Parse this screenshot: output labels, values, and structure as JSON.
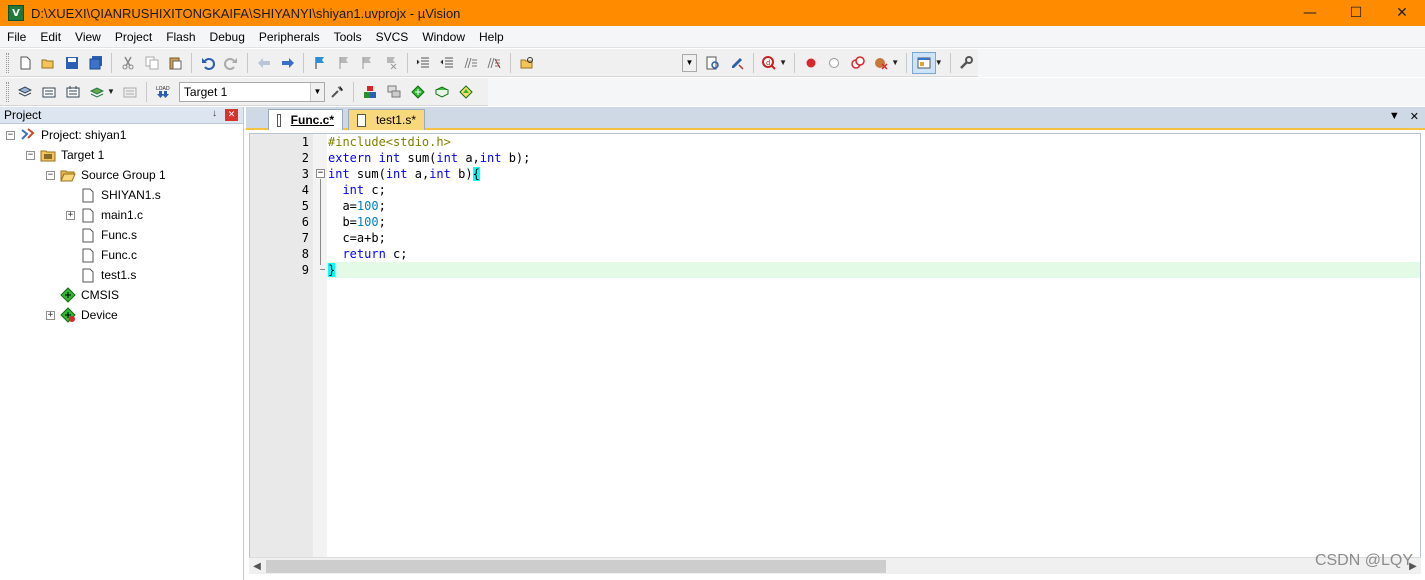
{
  "window": {
    "title": "D:\\XUEXI\\QIANRUSHIXITONGKAIFA\\SHIYANYI\\shiyan1.uvprojx - µVision",
    "app_icon_letter": "V"
  },
  "menu": [
    "File",
    "Edit",
    "View",
    "Project",
    "Flash",
    "Debug",
    "Peripherals",
    "Tools",
    "SVCS",
    "Window",
    "Help"
  ],
  "toolbar2": {
    "target": "Target 1"
  },
  "project_panel": {
    "title": "Project",
    "tree": {
      "project": "Project: shiyan1",
      "target": "Target 1",
      "group": "Source Group 1",
      "files": [
        "SHIYAN1.s",
        "main1.c",
        "Func.s",
        "Func.c",
        "test1.s"
      ],
      "cmsis": "CMSIS",
      "device": "Device"
    }
  },
  "editor": {
    "tabs": [
      "Func.c*",
      "test1.s*"
    ],
    "line_numbers": [
      "1",
      "2",
      "3",
      "4",
      "5",
      "6",
      "7",
      "8",
      "9"
    ]
  },
  "watermark": "CSDN @LQY",
  "colors": {
    "title_bar": "#ff8c00",
    "keyword": "#0000ff",
    "preprocessor": "#808000",
    "number": "#0080c0",
    "current_line": "#e3fbe6"
  }
}
